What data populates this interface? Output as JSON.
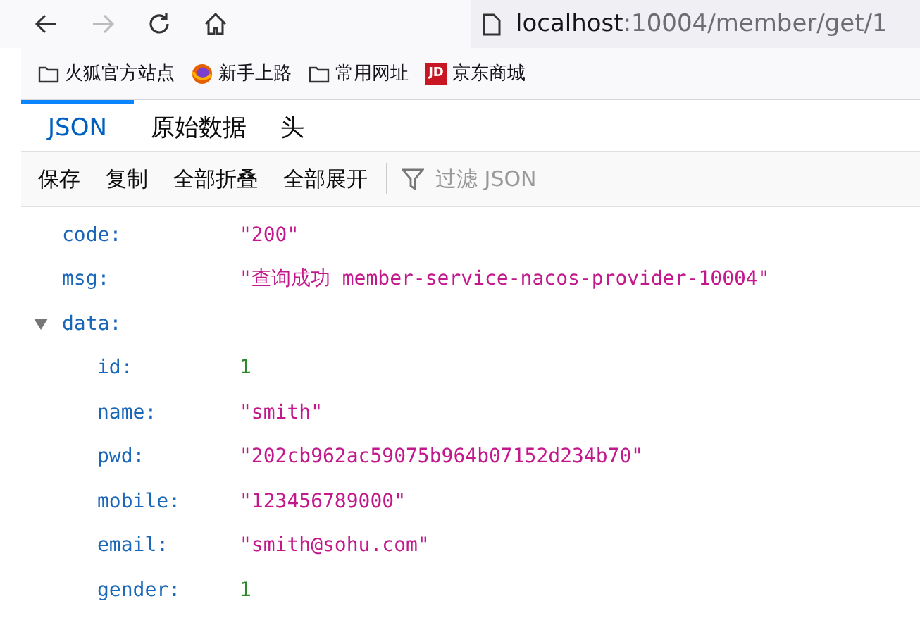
{
  "nav": {
    "back_disabled": false,
    "forward_disabled": true
  },
  "url": {
    "host": "localhost",
    "path": ":10004/member/get/1"
  },
  "bookmarks": [
    {
      "label": "火狐官方站点",
      "kind": "folder"
    },
    {
      "label": "新手上路",
      "kind": "firefox"
    },
    {
      "label": "常用网址",
      "kind": "folder"
    },
    {
      "label": "京东商城",
      "kind": "jd",
      "icon_text": "JD"
    }
  ],
  "tabs": [
    {
      "label": "JSON",
      "selected": true
    },
    {
      "label": "原始数据",
      "selected": false
    },
    {
      "label": "头",
      "selected": false
    }
  ],
  "toolbar": {
    "buttons": [
      "保存",
      "复制",
      "全部折叠",
      "全部展开"
    ],
    "filter": {
      "placeholder": "过滤 JSON"
    }
  },
  "rows": [
    {
      "key": "code:",
      "value": "\"200\"",
      "kind": "string"
    },
    {
      "key": "msg:",
      "value": "\"查询成功 member-service-nacos-provider-10004\"",
      "kind": "string"
    },
    {
      "key": "data:",
      "kind": "object",
      "expanded": true,
      "children": [
        {
          "key": "id:",
          "value": "1",
          "kind": "number"
        },
        {
          "key": "name:",
          "value": "\"smith\"",
          "kind": "string"
        },
        {
          "key": "pwd:",
          "value": "\"202cb962ac59075b964b07152d234b70\"",
          "kind": "string"
        },
        {
          "key": "mobile:",
          "value": "\"123456789000\"",
          "kind": "string"
        },
        {
          "key": "email:",
          "value": "\"smith@sohu.com\"",
          "kind": "string"
        },
        {
          "key": "gender:",
          "value": "1",
          "kind": "number"
        }
      ]
    }
  ]
}
